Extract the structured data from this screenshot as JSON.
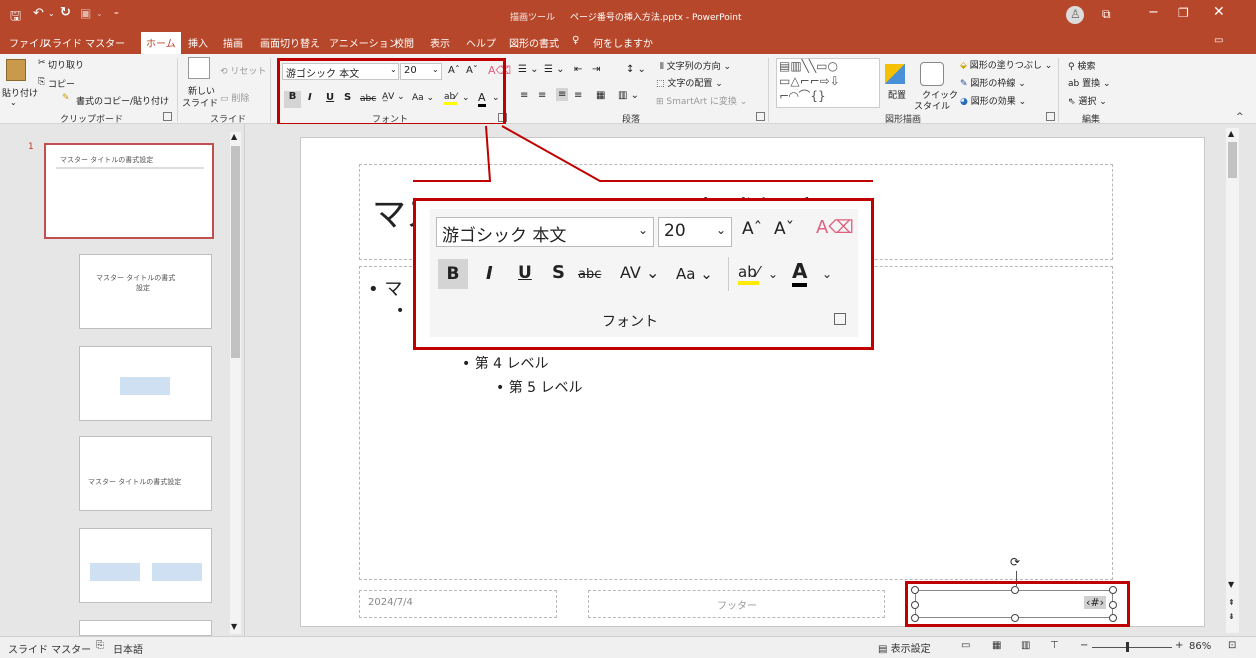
{
  "titlebar": {
    "contextual": "描画ツール",
    "filename": "ページ番号の挿入方法.pptx",
    "separator": "-",
    "app": "PowerPoint"
  },
  "tabs": [
    "ファイル",
    "スライド マスター",
    "ホーム",
    "挿入",
    "描画",
    "画面切り替え",
    "アニメーション",
    "校閲",
    "表示",
    "ヘルプ",
    "図形の書式"
  ],
  "active_tab": "ホーム",
  "tellme": "何をしますか",
  "ribbon": {
    "clipboard": {
      "paste": "貼り付け",
      "cut": "切り取り",
      "copy": "コピー",
      "format_painter": "書式のコピー/貼り付け",
      "label": "クリップボード"
    },
    "slides": {
      "new_slide": "新しい",
      "new_slide2": "スライド",
      "reset": "リセット",
      "delete": "削除",
      "label": "スライド"
    },
    "font": {
      "name": "游ゴシック 本文",
      "size": "20",
      "label": "フォント"
    },
    "paragraph": {
      "text_direction": "文字列の方向",
      "align_text": "文字の配置",
      "smartart": "SmartArt に変換",
      "label": "段落"
    },
    "drawing": {
      "arrange": "配置",
      "quick_styles": "クイック",
      "quick_styles2": "スタイル",
      "fill": "図形の塗りつぶし",
      "outline": "図形の枠線",
      "effects": "図形の効果",
      "label": "図形描画"
    },
    "editing": {
      "find": "検索",
      "replace": "置換",
      "select": "選択",
      "label": "編集"
    }
  },
  "thumbs": {
    "num": "1",
    "t1": "マスター タイトルの書式設定",
    "t2a": "マスター タイトルの書式",
    "t2b": "設定",
    "t4": "マスター タイトルの書式設定"
  },
  "slide": {
    "title": "マスター タイトルの書式設定",
    "bullet1": "マ",
    "level4": "第 4 レベル",
    "level5": "第 5 レベル",
    "date": "2024/7/4",
    "footer": "フッター",
    "number": "‹#›"
  },
  "zoom": {
    "font_name": "游ゴシック 本文",
    "font_size": "20",
    "group_label": "フォント"
  },
  "status": {
    "view": "スライド マスター",
    "lang": "日本語",
    "display_settings": "表示設定",
    "zoom": "86%"
  }
}
